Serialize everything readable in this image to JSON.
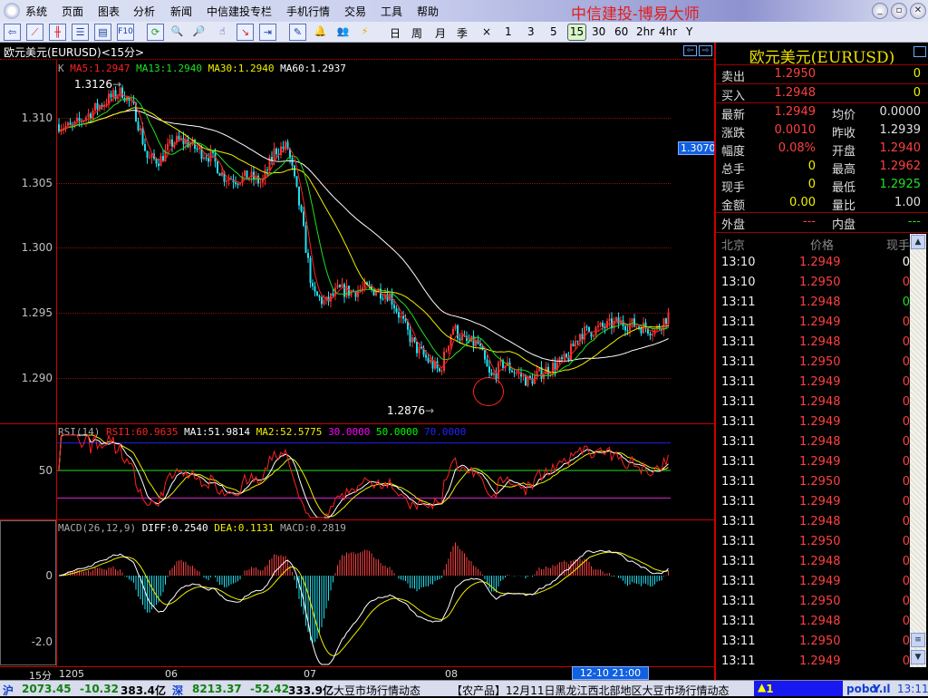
{
  "app": {
    "title": "中信建投-博易大师",
    "menu": [
      "系统",
      "页面",
      "图表",
      "分析",
      "新闻",
      "中信建投专栏",
      "手机行情",
      "交易",
      "工具",
      "帮助"
    ],
    "window_buttons": [
      "minimize",
      "restore",
      "close"
    ]
  },
  "toolbar": {
    "icons": [
      "back-icon",
      "line-chart-icon",
      "candle-chart-icon",
      "list-icon",
      "quote-icon",
      "f10-icon",
      "refresh-icon",
      "zoom-in-icon",
      "zoom-out-icon",
      "cursor-icon",
      "window-icon",
      "panel-icon",
      "draw-icon",
      "alarm-icon",
      "users-icon",
      "flash-icon"
    ],
    "f10_label": "F10",
    "periods": [
      "日",
      "周",
      "月",
      "季",
      "×",
      "1",
      "3",
      "5",
      "15",
      "30",
      "60",
      "2hr",
      "4hr",
      "Y"
    ],
    "active_period": "15"
  },
  "chart": {
    "header": "欧元美元(EURUSD)<15分>",
    "legend": {
      "k": "K",
      "ma5": "MA5:1.2947",
      "ma13": "MA13:1.2940",
      "ma30": "MA30:1.2940",
      "ma60": "MA60:1.2937"
    },
    "cursor_price": "1.3070",
    "period_label": "15分",
    "cursor_time": "12-10 21:00"
  },
  "chart_data": {
    "type": "candlestick",
    "price_axis": {
      "ticks": [
        "1.310",
        "1.305",
        "1.300",
        "1.295",
        "1.290"
      ],
      "ylim": [
        1.286,
        1.3145
      ]
    },
    "time_labels": [
      "1205",
      "06",
      "07",
      "08"
    ],
    "high_label": "1.3126",
    "low_label": "1.2876",
    "close_path": [
      1.3095,
      1.3092,
      1.31,
      1.3108,
      1.3115,
      1.312,
      1.3105,
      1.3068,
      1.3068,
      1.3082,
      1.3082,
      1.3075,
      1.307,
      1.3055,
      1.3053,
      1.3055,
      1.305,
      1.3075,
      1.3078,
      1.303,
      1.2965,
      1.2958,
      1.2968,
      1.2967,
      1.2969,
      1.2968,
      1.2965,
      1.2945,
      1.2925,
      1.2915,
      1.2905,
      1.294,
      1.2928,
      1.2927,
      1.29,
      1.2912,
      1.2905,
      1.2898,
      1.2905,
      1.291,
      1.2915,
      1.2935,
      1.2937,
      1.294,
      1.2943,
      1.2942,
      1.294,
      1.2937,
      1.2949
    ],
    "ma_periods": [
      5,
      13,
      30,
      60
    ],
    "series_colors": {
      "up": "#ff3030",
      "down": "#20e0f0",
      "ma5": "#ff2020",
      "ma13": "#20e020",
      "ma30": "#f0f000",
      "ma60": "#ffffff"
    },
    "rsi": {
      "legend": {
        "name": "RSI(14)",
        "rsi1": "RSI1:60.9635",
        "ma1": "MA1:51.9814",
        "ma2": "MA2:52.5775",
        "l30": "30.0000",
        "l50": "50.0000",
        "l70": "70.0000"
      },
      "axis_tick": "50",
      "levels": [
        30,
        50,
        70
      ]
    },
    "macd": {
      "legend": {
        "name": "MACD(26,12,9)",
        "diff": "DIFF:0.2540",
        "dea": "DEA:0.1131",
        "macd": "MACD:0.2819"
      },
      "axis_ticks": [
        "0",
        "-2.0"
      ]
    }
  },
  "quote": {
    "title": "欧元美元(EURUSD)",
    "sell": {
      "label": "卖出",
      "price": "1.2950",
      "vol": "0"
    },
    "buy": {
      "label": "买入",
      "price": "1.2948",
      "vol": "0"
    },
    "rows": [
      {
        "l1": "最新",
        "v1": "1.2949",
        "l2": "均价",
        "v2": "0.0000",
        "c1": "#ff4040",
        "c2": "#e0e0e0"
      },
      {
        "l1": "涨跌",
        "v1": "0.0010",
        "l2": "昨收",
        "v2": "1.2939",
        "c1": "#ff4040",
        "c2": "#e0e0e0"
      },
      {
        "l1": "幅度",
        "v1": "0.08%",
        "l2": "开盘",
        "v2": "1.2940",
        "c1": "#ff4040",
        "c2": "#ff4040"
      },
      {
        "l1": "总手",
        "v1": "0",
        "l2": "最高",
        "v2": "1.2962",
        "c1": "#f0f000",
        "c2": "#ff4040"
      },
      {
        "l1": "现手",
        "v1": "0",
        "l2": "最低",
        "v2": "1.2925",
        "c1": "#f0f000",
        "c2": "#20e020"
      },
      {
        "l1": "金额",
        "v1": "0.00",
        "l2": "量比",
        "v2": "1.00",
        "c1": "#f0f000",
        "c2": "#e0e0e0"
      }
    ],
    "outer": {
      "label": "外盘",
      "value": "---"
    },
    "inner": {
      "label": "内盘",
      "value": "---"
    }
  },
  "ticks": {
    "headers": [
      "北京",
      "价格",
      "现手"
    ],
    "rows": [
      {
        "t": "13:10",
        "p": "1.2949",
        "v": "0",
        "vc": "#ffffff"
      },
      {
        "t": "13:10",
        "p": "1.2950",
        "v": "0",
        "vc": "#ff4040"
      },
      {
        "t": "13:11",
        "p": "1.2948",
        "v": "0",
        "vc": "#20e020"
      },
      {
        "t": "13:11",
        "p": "1.2949",
        "v": "0",
        "vc": "#ff4040"
      },
      {
        "t": "13:11",
        "p": "1.2948",
        "v": "0",
        "vc": "#ff4040"
      },
      {
        "t": "13:11",
        "p": "1.2950",
        "v": "0",
        "vc": "#ff4040"
      },
      {
        "t": "13:11",
        "p": "1.2949",
        "v": "0",
        "vc": "#ff4040"
      },
      {
        "t": "13:11",
        "p": "1.2948",
        "v": "0",
        "vc": "#ff4040"
      },
      {
        "t": "13:11",
        "p": "1.2949",
        "v": "0",
        "vc": "#ff4040"
      },
      {
        "t": "13:11",
        "p": "1.2948",
        "v": "0",
        "vc": "#ff4040"
      },
      {
        "t": "13:11",
        "p": "1.2949",
        "v": "0",
        "vc": "#ff4040"
      },
      {
        "t": "13:11",
        "p": "1.2950",
        "v": "0",
        "vc": "#ff4040"
      },
      {
        "t": "13:11",
        "p": "1.2949",
        "v": "0",
        "vc": "#ff4040"
      },
      {
        "t": "13:11",
        "p": "1.2948",
        "v": "0",
        "vc": "#ff4040"
      },
      {
        "t": "13:11",
        "p": "1.2950",
        "v": "0",
        "vc": "#ff4040"
      },
      {
        "t": "13:11",
        "p": "1.2948",
        "v": "0",
        "vc": "#ff4040"
      },
      {
        "t": "13:11",
        "p": "1.2949",
        "v": "0",
        "vc": "#ff4040"
      },
      {
        "t": "13:11",
        "p": "1.2950",
        "v": "0",
        "vc": "#ff4040"
      },
      {
        "t": "13:11",
        "p": "1.2948",
        "v": "0",
        "vc": "#ff4040"
      },
      {
        "t": "13:11",
        "p": "1.2950",
        "v": "0",
        "vc": "#ff4040"
      },
      {
        "t": "13:11",
        "p": "1.2949",
        "v": "0",
        "vc": "#ff4040"
      }
    ]
  },
  "status": {
    "sh_label": "沪",
    "sh_index": "2073.45",
    "sh_change": "-10.32",
    "sh_amount": "383.4亿",
    "sz_label": "深",
    "sz_index": "8213.37",
    "sz_change": "-52.42",
    "sz_amount": "333.9亿",
    "news1": "大豆市场行情动态",
    "news2": "【农产品】12月11日黑龙江西北部地区大豆市场行情动态",
    "alert": "1",
    "brand": "pobo",
    "time": "13:11"
  }
}
